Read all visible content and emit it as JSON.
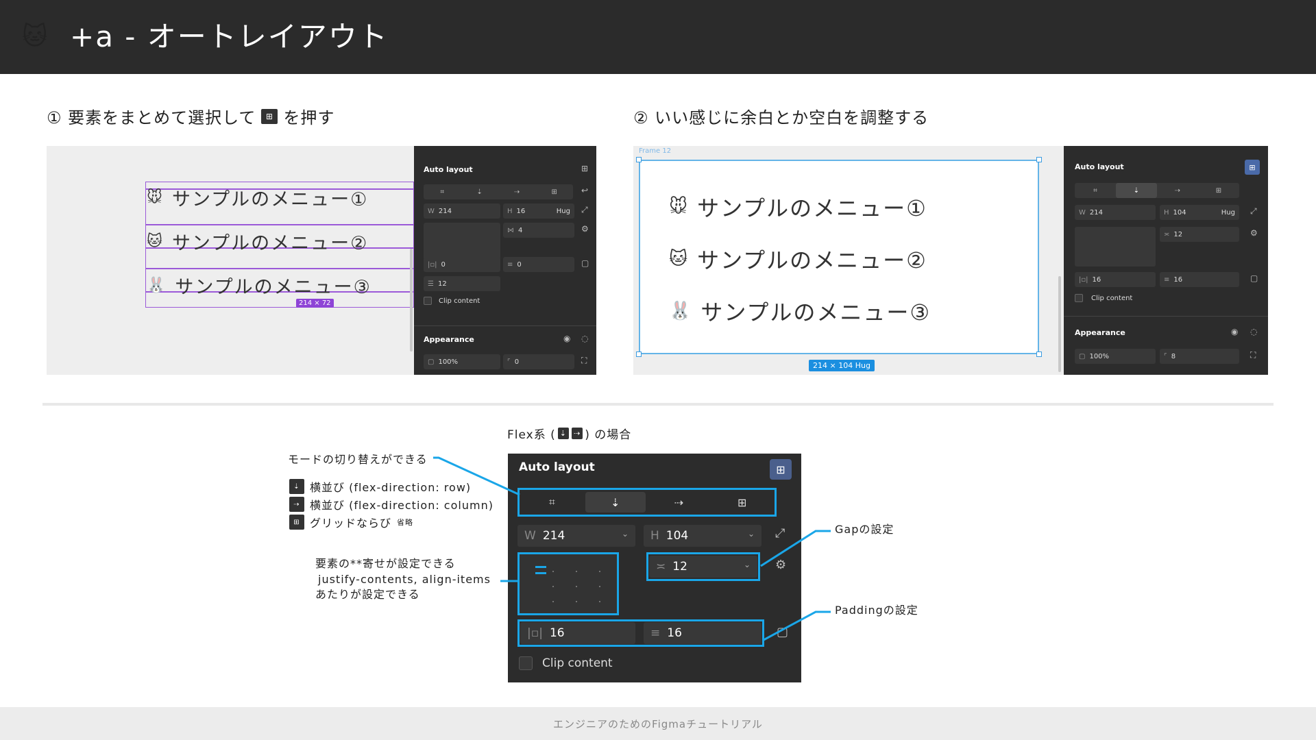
{
  "header": {
    "icon": "🐱",
    "title": "+a - オートレイアウト"
  },
  "steps": {
    "step1_prefix": "① 要素をまとめて選択して",
    "step1_suffix": "を押す",
    "step2": "② いい感じに余白とか空白を調整する"
  },
  "shot1": {
    "items": [
      {
        "emoji": "🐭",
        "label": "サンプルのメニュー①"
      },
      {
        "emoji": "🐱",
        "label": "サンプルのメニュー②"
      },
      {
        "emoji": "🐰",
        "label": "サンプルのメニュー③"
      }
    ],
    "size_badge": "214 × 72",
    "panel": {
      "title": "Auto layout",
      "w_label": "W",
      "w_value": "214",
      "h_label": "H",
      "h_value": "16",
      "h_mode": "Hug",
      "gap_value": "4",
      "pad_h": "0",
      "pad_v": "0",
      "spacing": "12",
      "clip": "Clip content",
      "appearance": "Appearance",
      "opacity": "100%",
      "radius": "0"
    }
  },
  "shot2": {
    "frame_label": "Frame 12",
    "items": [
      {
        "emoji": "🐭",
        "label": "サンプルのメニュー①"
      },
      {
        "emoji": "🐱",
        "label": "サンプルのメニュー②"
      },
      {
        "emoji": "🐰",
        "label": "サンプルのメニュー③"
      }
    ],
    "size_badge": "214 × 104 Hug",
    "panel": {
      "title": "Auto layout",
      "w_label": "W",
      "w_value": "214",
      "h_label": "H",
      "h_value": "104",
      "h_mode": "Hug",
      "gap_value": "12",
      "pad_h": "16",
      "pad_v": "16",
      "clip": "Clip content",
      "appearance": "Appearance",
      "opacity": "100%",
      "radius": "8"
    }
  },
  "explain": {
    "caption_prefix": "Flex系 (",
    "caption_suffix": ") の場合",
    "panel": {
      "title": "Auto layout",
      "w_label": "W",
      "w_value": "214",
      "h_label": "H",
      "h_value": "104",
      "gap_value": "12",
      "pad_h": "16",
      "pad_v": "16",
      "clip": "Clip content"
    },
    "mode_note": "モードの切り替えができる",
    "legend": [
      {
        "text": "横並び (flex-direction: row)",
        "extra": ""
      },
      {
        "text": "横並び (flex-direction: column)",
        "extra": ""
      },
      {
        "text": "グリッドならび",
        "extra": "省略"
      }
    ],
    "align_note": [
      "要素の**寄せが設定できる",
      "justify-contents, align-items",
      "あたりが設定できる"
    ],
    "gap_note": "Gapの設定",
    "padding_note": "Paddingの設定"
  },
  "footer": {
    "text": "エンジニアのためのFigmaチュートリアル"
  },
  "colors": {
    "accent": "#1aa6e8",
    "selection": "#9b59d8",
    "frame": "#64b4e8",
    "header_bg": "#2b2b2b"
  }
}
